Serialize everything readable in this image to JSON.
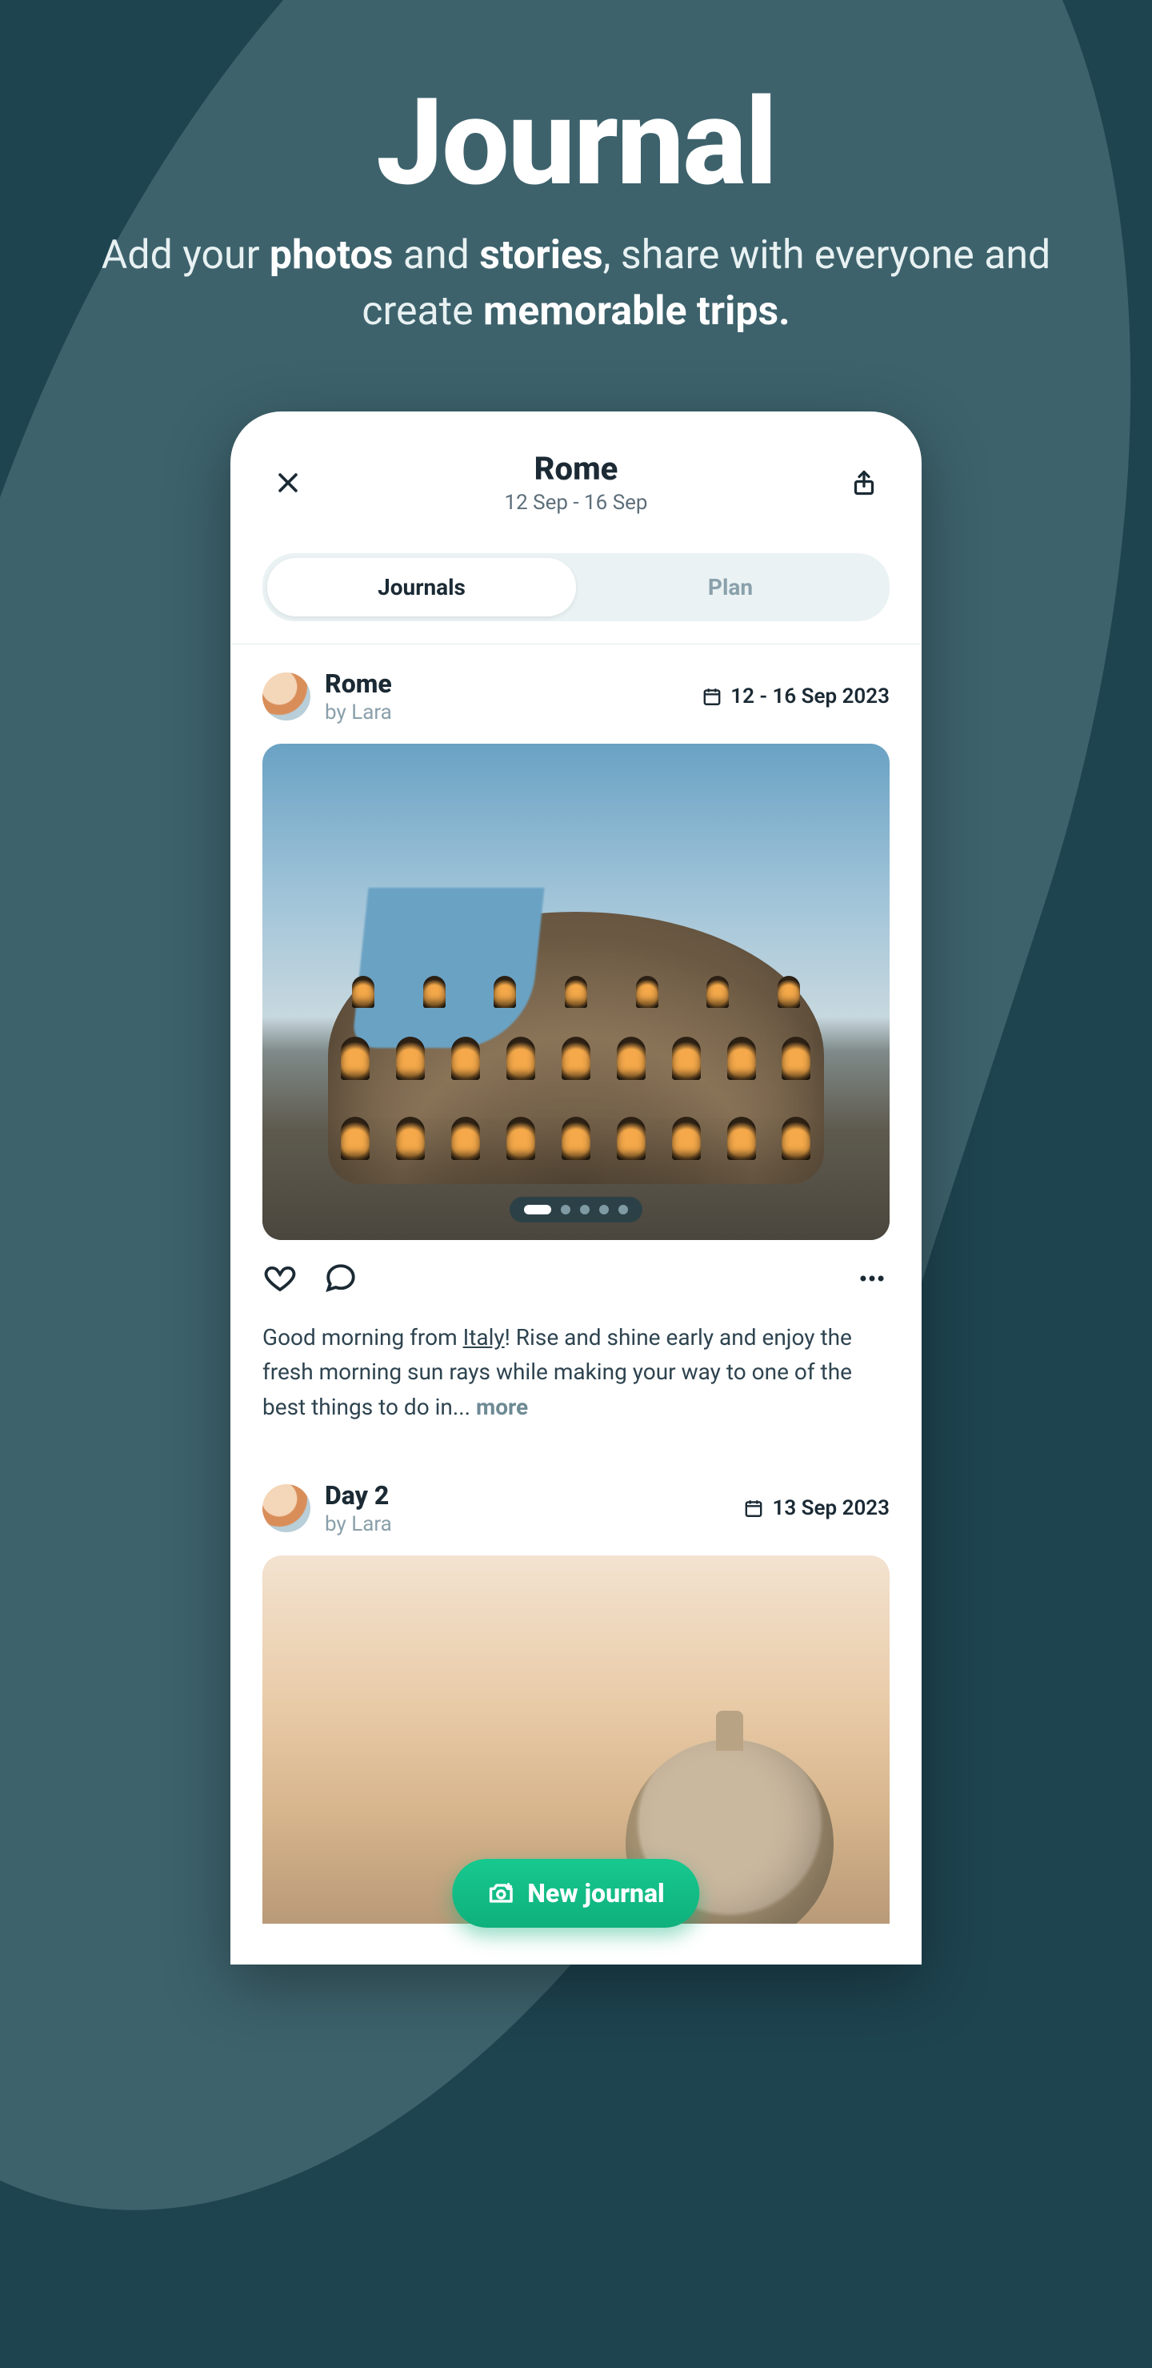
{
  "hero": {
    "title": "Journal",
    "sub_prefix": "Add your ",
    "sub_b1": "photos",
    "sub_mid1": " and ",
    "sub_b2": "stories",
    "sub_mid2": ", share with everyone and create ",
    "sub_b3": "memorable trips."
  },
  "topbar": {
    "title": "Rome",
    "dates": "12 Sep - 16 Sep"
  },
  "tabs": {
    "journals": "Journals",
    "plan": "Plan"
  },
  "post1": {
    "title": "Rome",
    "by_prefix": "by ",
    "author": "Lara",
    "date": "12 - 16 Sep 2023",
    "caption_a": "Good morning from ",
    "caption_italy": "Italy",
    "caption_b": "! Rise and shine early and enjoy the fresh morning sun rays while making your way to one of the best things to do in... ",
    "more": "more"
  },
  "post2": {
    "title": "Day 2",
    "by_prefix": "by ",
    "author": "Lara",
    "date": "13 Sep 2023"
  },
  "fab": {
    "label": "New journal"
  },
  "carousel": {
    "total": 5,
    "active": 0
  }
}
